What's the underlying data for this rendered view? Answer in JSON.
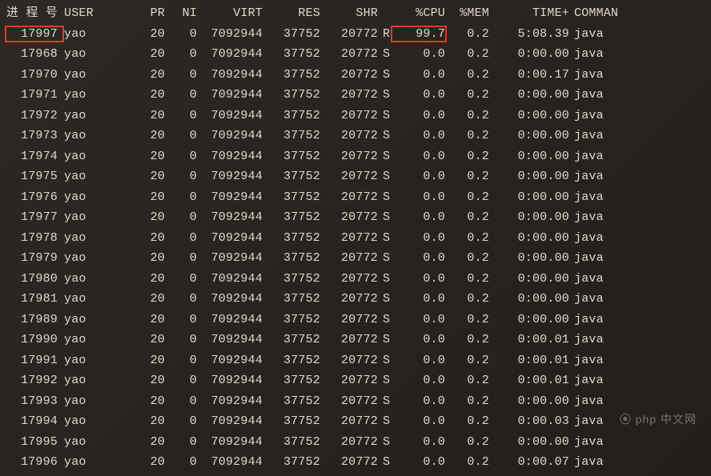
{
  "headers": {
    "pid": "进 程 号",
    "user": "USER",
    "pr": "PR",
    "ni": "NI",
    "virt": "VIRT",
    "res": "RES",
    "shr": "SHR",
    "st": "",
    "cpu": "%CPU",
    "mem": "%MEM",
    "time": "TIME+",
    "cmd": "COMMAN"
  },
  "highlight": {
    "row": 0,
    "cols": [
      "pid",
      "cpu"
    ]
  },
  "rows": [
    {
      "pid": "17997",
      "user": "yao",
      "pr": "20",
      "ni": "0",
      "virt": "7092944",
      "res": "37752",
      "shr": "20772",
      "st": "R",
      "cpu": "99.7",
      "mem": "0.2",
      "time": "5:08.39",
      "cmd": "java"
    },
    {
      "pid": "17968",
      "user": "yao",
      "pr": "20",
      "ni": "0",
      "virt": "7092944",
      "res": "37752",
      "shr": "20772",
      "st": "S",
      "cpu": "0.0",
      "mem": "0.2",
      "time": "0:00.00",
      "cmd": "java"
    },
    {
      "pid": "17970",
      "user": "yao",
      "pr": "20",
      "ni": "0",
      "virt": "7092944",
      "res": "37752",
      "shr": "20772",
      "st": "S",
      "cpu": "0.0",
      "mem": "0.2",
      "time": "0:00.17",
      "cmd": "java"
    },
    {
      "pid": "17971",
      "user": "yao",
      "pr": "20",
      "ni": "0",
      "virt": "7092944",
      "res": "37752",
      "shr": "20772",
      "st": "S",
      "cpu": "0.0",
      "mem": "0.2",
      "time": "0:00.00",
      "cmd": "java"
    },
    {
      "pid": "17972",
      "user": "yao",
      "pr": "20",
      "ni": "0",
      "virt": "7092944",
      "res": "37752",
      "shr": "20772",
      "st": "S",
      "cpu": "0.0",
      "mem": "0.2",
      "time": "0:00.00",
      "cmd": "java"
    },
    {
      "pid": "17973",
      "user": "yao",
      "pr": "20",
      "ni": "0",
      "virt": "7092944",
      "res": "37752",
      "shr": "20772",
      "st": "S",
      "cpu": "0.0",
      "mem": "0.2",
      "time": "0:00.00",
      "cmd": "java"
    },
    {
      "pid": "17974",
      "user": "yao",
      "pr": "20",
      "ni": "0",
      "virt": "7092944",
      "res": "37752",
      "shr": "20772",
      "st": "S",
      "cpu": "0.0",
      "mem": "0.2",
      "time": "0:00.00",
      "cmd": "java"
    },
    {
      "pid": "17975",
      "user": "yao",
      "pr": "20",
      "ni": "0",
      "virt": "7092944",
      "res": "37752",
      "shr": "20772",
      "st": "S",
      "cpu": "0.0",
      "mem": "0.2",
      "time": "0:00.00",
      "cmd": "java"
    },
    {
      "pid": "17976",
      "user": "yao",
      "pr": "20",
      "ni": "0",
      "virt": "7092944",
      "res": "37752",
      "shr": "20772",
      "st": "S",
      "cpu": "0.0",
      "mem": "0.2",
      "time": "0:00.00",
      "cmd": "java"
    },
    {
      "pid": "17977",
      "user": "yao",
      "pr": "20",
      "ni": "0",
      "virt": "7092944",
      "res": "37752",
      "shr": "20772",
      "st": "S",
      "cpu": "0.0",
      "mem": "0.2",
      "time": "0:00.00",
      "cmd": "java"
    },
    {
      "pid": "17978",
      "user": "yao",
      "pr": "20",
      "ni": "0",
      "virt": "7092944",
      "res": "37752",
      "shr": "20772",
      "st": "S",
      "cpu": "0.0",
      "mem": "0.2",
      "time": "0:00.00",
      "cmd": "java"
    },
    {
      "pid": "17979",
      "user": "yao",
      "pr": "20",
      "ni": "0",
      "virt": "7092944",
      "res": "37752",
      "shr": "20772",
      "st": "S",
      "cpu": "0.0",
      "mem": "0.2",
      "time": "0:00.00",
      "cmd": "java"
    },
    {
      "pid": "17980",
      "user": "yao",
      "pr": "20",
      "ni": "0",
      "virt": "7092944",
      "res": "37752",
      "shr": "20772",
      "st": "S",
      "cpu": "0.0",
      "mem": "0.2",
      "time": "0:00.00",
      "cmd": "java"
    },
    {
      "pid": "17981",
      "user": "yao",
      "pr": "20",
      "ni": "0",
      "virt": "7092944",
      "res": "37752",
      "shr": "20772",
      "st": "S",
      "cpu": "0.0",
      "mem": "0.2",
      "time": "0:00.00",
      "cmd": "java"
    },
    {
      "pid": "17989",
      "user": "yao",
      "pr": "20",
      "ni": "0",
      "virt": "7092944",
      "res": "37752",
      "shr": "20772",
      "st": "S",
      "cpu": "0.0",
      "mem": "0.2",
      "time": "0:00.00",
      "cmd": "java"
    },
    {
      "pid": "17990",
      "user": "yao",
      "pr": "20",
      "ni": "0",
      "virt": "7092944",
      "res": "37752",
      "shr": "20772",
      "st": "S",
      "cpu": "0.0",
      "mem": "0.2",
      "time": "0:00.01",
      "cmd": "java"
    },
    {
      "pid": "17991",
      "user": "yao",
      "pr": "20",
      "ni": "0",
      "virt": "7092944",
      "res": "37752",
      "shr": "20772",
      "st": "S",
      "cpu": "0.0",
      "mem": "0.2",
      "time": "0:00.01",
      "cmd": "java"
    },
    {
      "pid": "17992",
      "user": "yao",
      "pr": "20",
      "ni": "0",
      "virt": "7092944",
      "res": "37752",
      "shr": "20772",
      "st": "S",
      "cpu": "0.0",
      "mem": "0.2",
      "time": "0:00.01",
      "cmd": "java"
    },
    {
      "pid": "17993",
      "user": "yao",
      "pr": "20",
      "ni": "0",
      "virt": "7092944",
      "res": "37752",
      "shr": "20772",
      "st": "S",
      "cpu": "0.0",
      "mem": "0.2",
      "time": "0:00.00",
      "cmd": "java"
    },
    {
      "pid": "17994",
      "user": "yao",
      "pr": "20",
      "ni": "0",
      "virt": "7092944",
      "res": "37752",
      "shr": "20772",
      "st": "S",
      "cpu": "0.0",
      "mem": "0.2",
      "time": "0:00.03",
      "cmd": "java"
    },
    {
      "pid": "17995",
      "user": "yao",
      "pr": "20",
      "ni": "0",
      "virt": "7092944",
      "res": "37752",
      "shr": "20772",
      "st": "S",
      "cpu": "0.0",
      "mem": "0.2",
      "time": "0:00.00",
      "cmd": "java"
    },
    {
      "pid": "17996",
      "user": "yao",
      "pr": "20",
      "ni": "0",
      "virt": "7092944",
      "res": "37752",
      "shr": "20772",
      "st": "S",
      "cpu": "0.0",
      "mem": "0.2",
      "time": "0:00.07",
      "cmd": "java"
    }
  ],
  "watermark": "php 中文网"
}
